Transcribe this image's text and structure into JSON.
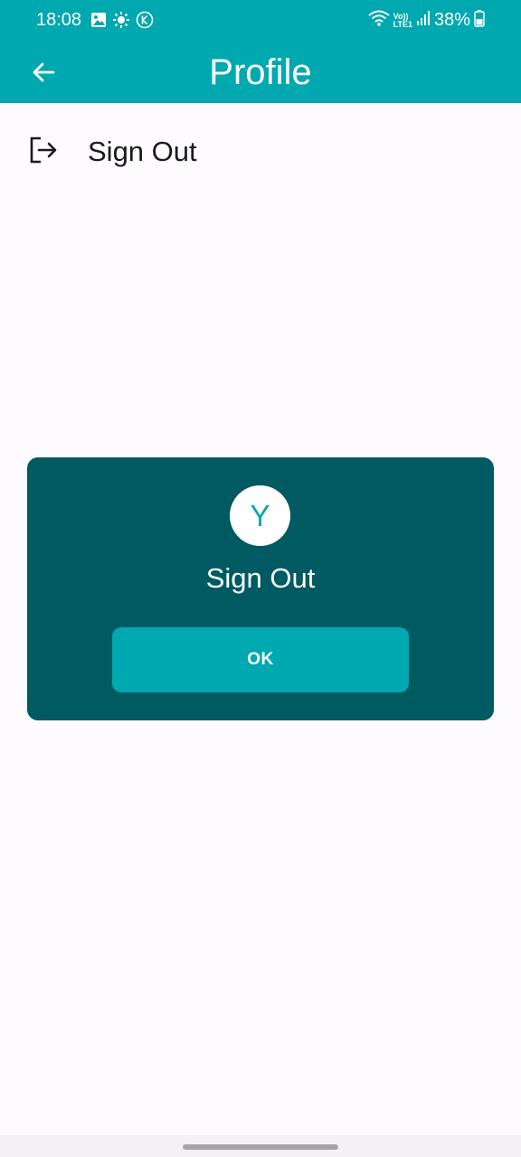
{
  "status_bar": {
    "time": "18:08",
    "battery": "38%",
    "network_label_top": "Vo))",
    "network_label_bottom": "LTE1",
    "notification_icons": [
      "image-icon",
      "brightness-icon",
      "k-badge-icon"
    ],
    "system_icons": [
      "wifi-icon",
      "volte-lte-icon",
      "signal-icon",
      "battery-icon"
    ]
  },
  "app_bar": {
    "title": "Profile",
    "back_icon": "arrow-left-icon"
  },
  "menu": {
    "sign_out_label": "Sign Out",
    "sign_out_icon": "logout-icon"
  },
  "dialog": {
    "avatar_letter": "Y",
    "title": "Sign Out",
    "ok_label": "OK"
  },
  "colors": {
    "primary": "#00a8b0",
    "dialog_background": "#005a62",
    "page_background": "#fdfbfe"
  }
}
